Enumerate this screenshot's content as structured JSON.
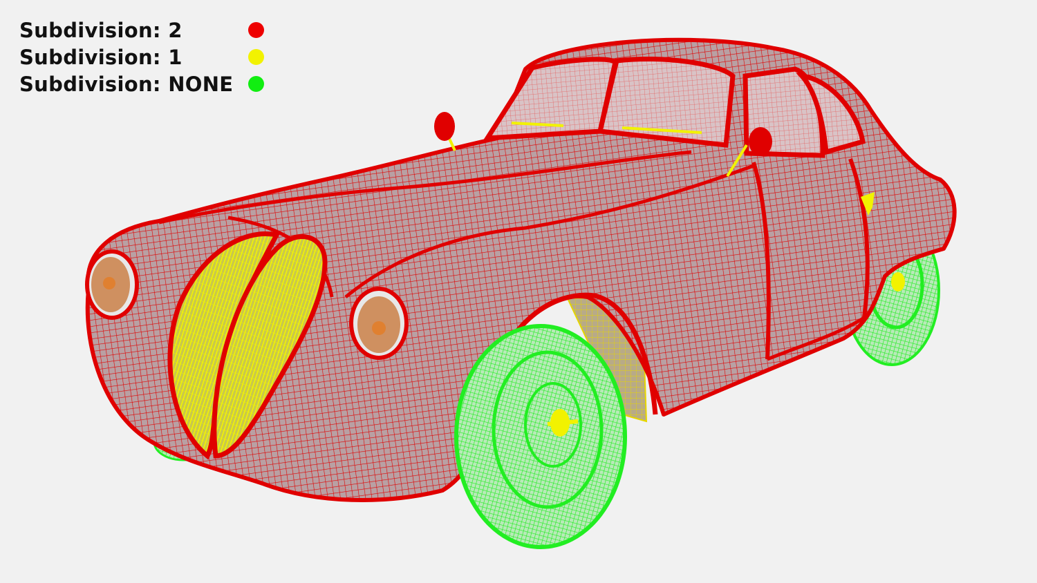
{
  "legend": [
    {
      "label": "Subdivision: 2",
      "color": "#ee0000"
    },
    {
      "label": "Subdivision: 1",
      "color": "#f2f200"
    },
    {
      "label": "Subdivision: NONE",
      "color": "#11ee11"
    }
  ],
  "colors": {
    "background": "#f1f1f1",
    "body_wire": "#e00000",
    "body_fill": "#b9a0a3",
    "grille": "#e8e800",
    "wheels": "#22f022",
    "headlight": "#cf8040"
  },
  "scene_subject": "vintage-coupe-wireframe"
}
